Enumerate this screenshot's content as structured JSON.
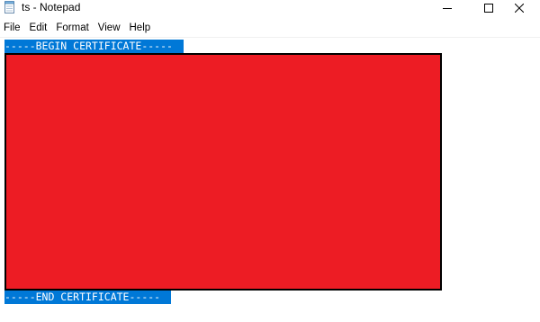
{
  "window": {
    "title": "ts - Notepad",
    "icon": "notepad-icon"
  },
  "window_controls": {
    "minimize_icon": "minimize-icon",
    "maximize_icon": "maximize-icon",
    "close_icon": "close-icon"
  },
  "menu": {
    "items": [
      "File",
      "Edit",
      "Format",
      "View",
      "Help"
    ]
  },
  "editor": {
    "lines": [
      "-----BEGIN CERTIFICATE-----",
      "-----END CERTIFICATE-----"
    ],
    "selection_color": "#0078d7",
    "selection_text_color": "#ffffff",
    "redaction_color": "#ed1c24",
    "redaction_border_color": "#000000"
  }
}
